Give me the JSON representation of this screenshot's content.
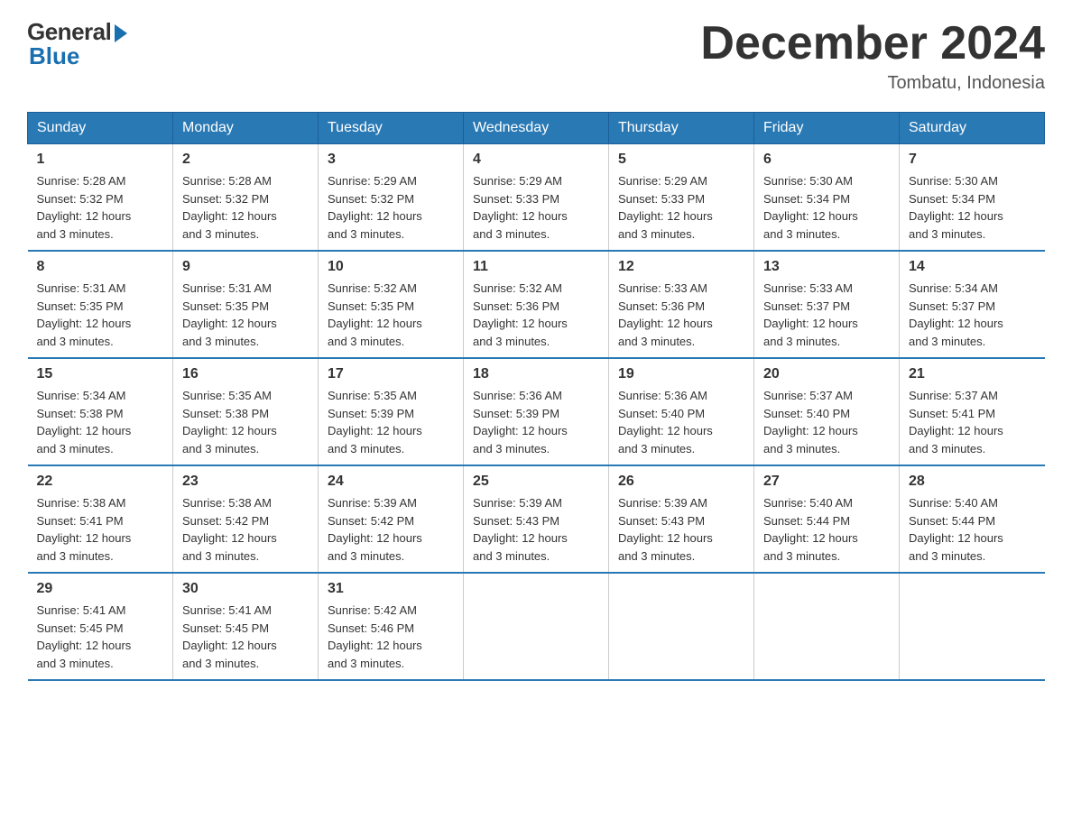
{
  "logo": {
    "general": "General",
    "blue": "Blue"
  },
  "title": "December 2024",
  "location": "Tombatu, Indonesia",
  "days_of_week": [
    "Sunday",
    "Monday",
    "Tuesday",
    "Wednesday",
    "Thursday",
    "Friday",
    "Saturday"
  ],
  "weeks": [
    [
      {
        "day": "1",
        "sunrise": "5:28 AM",
        "sunset": "5:32 PM",
        "daylight": "12 hours and 3 minutes."
      },
      {
        "day": "2",
        "sunrise": "5:28 AM",
        "sunset": "5:32 PM",
        "daylight": "12 hours and 3 minutes."
      },
      {
        "day": "3",
        "sunrise": "5:29 AM",
        "sunset": "5:32 PM",
        "daylight": "12 hours and 3 minutes."
      },
      {
        "day": "4",
        "sunrise": "5:29 AM",
        "sunset": "5:33 PM",
        "daylight": "12 hours and 3 minutes."
      },
      {
        "day": "5",
        "sunrise": "5:29 AM",
        "sunset": "5:33 PM",
        "daylight": "12 hours and 3 minutes."
      },
      {
        "day": "6",
        "sunrise": "5:30 AM",
        "sunset": "5:34 PM",
        "daylight": "12 hours and 3 minutes."
      },
      {
        "day": "7",
        "sunrise": "5:30 AM",
        "sunset": "5:34 PM",
        "daylight": "12 hours and 3 minutes."
      }
    ],
    [
      {
        "day": "8",
        "sunrise": "5:31 AM",
        "sunset": "5:35 PM",
        "daylight": "12 hours and 3 minutes."
      },
      {
        "day": "9",
        "sunrise": "5:31 AM",
        "sunset": "5:35 PM",
        "daylight": "12 hours and 3 minutes."
      },
      {
        "day": "10",
        "sunrise": "5:32 AM",
        "sunset": "5:35 PM",
        "daylight": "12 hours and 3 minutes."
      },
      {
        "day": "11",
        "sunrise": "5:32 AM",
        "sunset": "5:36 PM",
        "daylight": "12 hours and 3 minutes."
      },
      {
        "day": "12",
        "sunrise": "5:33 AM",
        "sunset": "5:36 PM",
        "daylight": "12 hours and 3 minutes."
      },
      {
        "day": "13",
        "sunrise": "5:33 AM",
        "sunset": "5:37 PM",
        "daylight": "12 hours and 3 minutes."
      },
      {
        "day": "14",
        "sunrise": "5:34 AM",
        "sunset": "5:37 PM",
        "daylight": "12 hours and 3 minutes."
      }
    ],
    [
      {
        "day": "15",
        "sunrise": "5:34 AM",
        "sunset": "5:38 PM",
        "daylight": "12 hours and 3 minutes."
      },
      {
        "day": "16",
        "sunrise": "5:35 AM",
        "sunset": "5:38 PM",
        "daylight": "12 hours and 3 minutes."
      },
      {
        "day": "17",
        "sunrise": "5:35 AM",
        "sunset": "5:39 PM",
        "daylight": "12 hours and 3 minutes."
      },
      {
        "day": "18",
        "sunrise": "5:36 AM",
        "sunset": "5:39 PM",
        "daylight": "12 hours and 3 minutes."
      },
      {
        "day": "19",
        "sunrise": "5:36 AM",
        "sunset": "5:40 PM",
        "daylight": "12 hours and 3 minutes."
      },
      {
        "day": "20",
        "sunrise": "5:37 AM",
        "sunset": "5:40 PM",
        "daylight": "12 hours and 3 minutes."
      },
      {
        "day": "21",
        "sunrise": "5:37 AM",
        "sunset": "5:41 PM",
        "daylight": "12 hours and 3 minutes."
      }
    ],
    [
      {
        "day": "22",
        "sunrise": "5:38 AM",
        "sunset": "5:41 PM",
        "daylight": "12 hours and 3 minutes."
      },
      {
        "day": "23",
        "sunrise": "5:38 AM",
        "sunset": "5:42 PM",
        "daylight": "12 hours and 3 minutes."
      },
      {
        "day": "24",
        "sunrise": "5:39 AM",
        "sunset": "5:42 PM",
        "daylight": "12 hours and 3 minutes."
      },
      {
        "day": "25",
        "sunrise": "5:39 AM",
        "sunset": "5:43 PM",
        "daylight": "12 hours and 3 minutes."
      },
      {
        "day": "26",
        "sunrise": "5:39 AM",
        "sunset": "5:43 PM",
        "daylight": "12 hours and 3 minutes."
      },
      {
        "day": "27",
        "sunrise": "5:40 AM",
        "sunset": "5:44 PM",
        "daylight": "12 hours and 3 minutes."
      },
      {
        "day": "28",
        "sunrise": "5:40 AM",
        "sunset": "5:44 PM",
        "daylight": "12 hours and 3 minutes."
      }
    ],
    [
      {
        "day": "29",
        "sunrise": "5:41 AM",
        "sunset": "5:45 PM",
        "daylight": "12 hours and 3 minutes."
      },
      {
        "day": "30",
        "sunrise": "5:41 AM",
        "sunset": "5:45 PM",
        "daylight": "12 hours and 3 minutes."
      },
      {
        "day": "31",
        "sunrise": "5:42 AM",
        "sunset": "5:46 PM",
        "daylight": "12 hours and 3 minutes."
      },
      null,
      null,
      null,
      null
    ]
  ],
  "labels": {
    "sunrise": "Sunrise:",
    "sunset": "Sunset:",
    "daylight": "Daylight:"
  },
  "colors": {
    "header_bg": "#2979b5",
    "header_text": "#ffffff",
    "border": "#2979b5",
    "accent_blue": "#1a6faf"
  }
}
